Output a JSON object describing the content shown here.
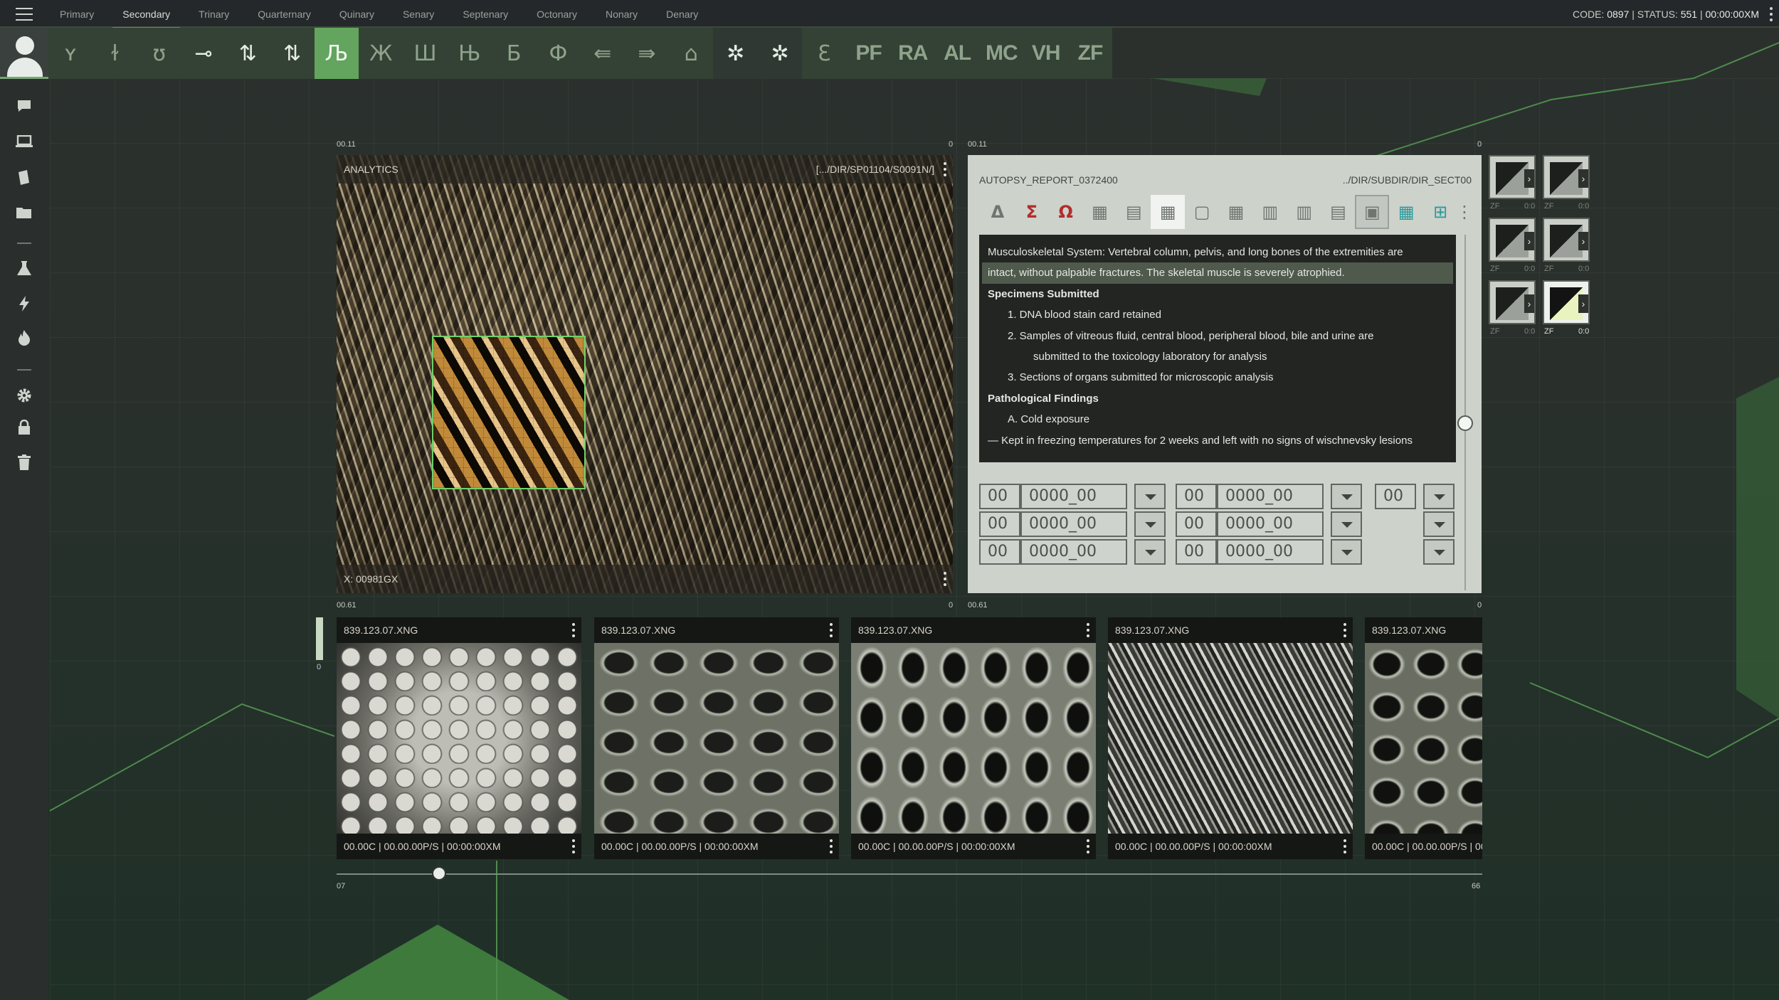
{
  "menu": {
    "items": [
      "Primary",
      "Secondary",
      "Trinary",
      "Quarternary",
      "Quinary",
      "Senary",
      "Septenary",
      "Octonary",
      "Nonary",
      "Denary"
    ],
    "active": "Secondary"
  },
  "status": {
    "code_label": "CODE:",
    "code": "0897",
    "status_label": "STATUS:",
    "status": "551",
    "time": "00:00:00XM"
  },
  "toolbar": {
    "glyphs": [
      "ʏ",
      "ɫ",
      "ʊ",
      "⊸",
      "⇅",
      "⇅",
      "Љ",
      "Ж",
      "Ш",
      "Њ",
      "Б",
      "Ф",
      "⇚",
      "⇛",
      "⌂",
      "✲",
      "✲",
      "Ɛ"
    ],
    "text_buttons": [
      "PF",
      "RA",
      "AL",
      "MC",
      "VH",
      "ZF"
    ],
    "active_glyph": "Љ"
  },
  "rail": {
    "icons": [
      "chat-icon",
      "laptop-icon",
      "document-icon",
      "folder-icon",
      "flask-icon",
      "bolt-icon",
      "flame-icon",
      "gear-icon",
      "lock-icon",
      "trash-icon"
    ]
  },
  "analytics": {
    "label_left": "00.11",
    "label_right": "0",
    "title": "ANALYTICS",
    "path": "[.../DIR/SP01104/S0091N/]",
    "footer": "X: 00981GX",
    "bottom_left": "00.61",
    "bottom_right": "0"
  },
  "report": {
    "label_left": "00.11",
    "label_right": "0",
    "title": "AUTOPSY_REPORT_0372400",
    "path": "../DIR/SUBDIR/DIR_SECT00",
    "tools": [
      "Δ",
      "Σ",
      "Ω",
      "▦",
      "▤",
      "▦",
      "▢",
      "▦",
      "▥",
      "▥",
      "▤",
      "▣",
      "▦",
      "⊞",
      "⋮"
    ],
    "lines": [
      "Musculoskeletal System: Vertebral column, pelvis, and long bones of the extremities are",
      "intact, without palpable fractures. The skeletal muscle is severely atrophied.",
      "Specimens Submitted",
      "1. DNA blood stain card retained",
      "2. Samples of vitreous fluid, central blood, peripheral blood, bile and urine are",
      "submitted to the toxicology laboratory for analysis",
      "3. Sections of organs submitted for microscopic analysis",
      "Pathological Findings",
      "A. Cold exposure",
      "— Kept in freezing temperatures for 2 weeks and left with no signs of wischnevsky lesions"
    ],
    "fields": {
      "num": "00",
      "code": "0000_00"
    },
    "bottom_left": "00.61",
    "bottom_right": "0"
  },
  "thumbs": {
    "label": "ZF",
    "value": "0:0"
  },
  "filmstrip": {
    "left_marker": "0",
    "items": [
      {
        "name": "839.123.07.XNG",
        "meta": "00.00C | 00.00.00P/S | 00:00:00XM"
      },
      {
        "name": "839.123.07.XNG",
        "meta": "00.00C | 00.00.00P/S | 00:00:00XM"
      },
      {
        "name": "839.123.07.XNG",
        "meta": "00.00C | 00.00.00P/S | 00:00:00XM"
      },
      {
        "name": "839.123.07.XNG",
        "meta": "00.00C | 00.00.00P/S | 00:00:00XM"
      },
      {
        "name": "839.123.07.XNG",
        "meta": "00.00C | 00.00.00P/S | 00"
      }
    ],
    "slider_min": "07",
    "slider_max": "66"
  },
  "colors": {
    "accent": "#63a55e",
    "accent_line": "#5f8f5c",
    "toolbar": "#344235"
  }
}
